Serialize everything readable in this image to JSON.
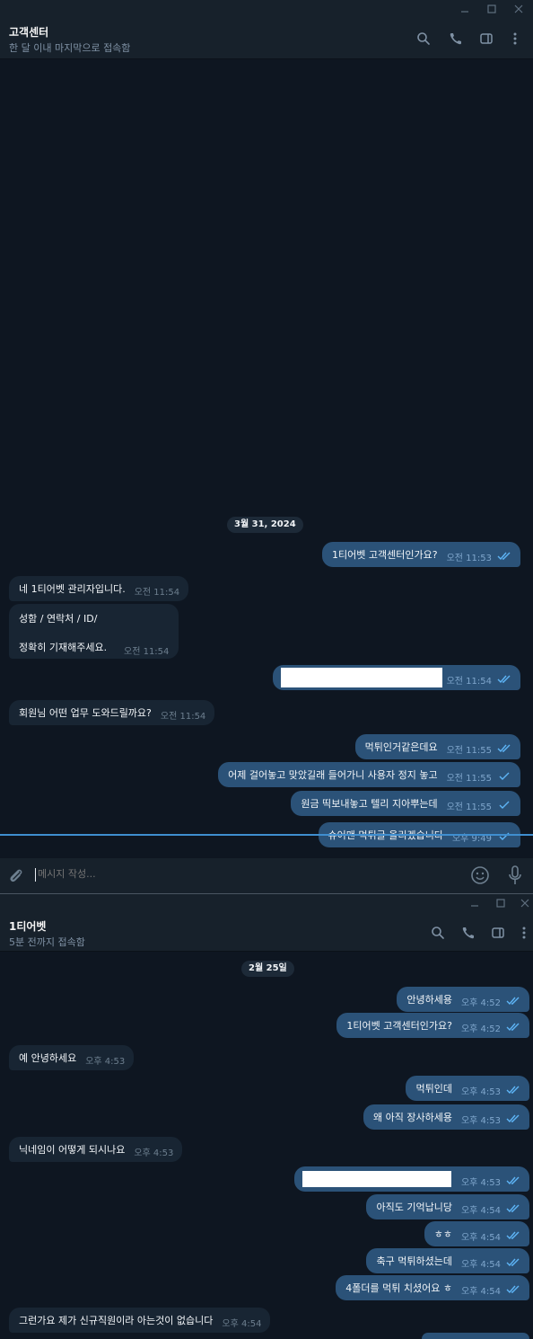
{
  "window1": {
    "title": "고객센터",
    "subtitle": "한 달 이내 마지막으로 접속함",
    "date": "3월 31, 2024",
    "composer_placeholder": "메시지 작성...",
    "messages": [
      {
        "dir": "out",
        "text": "1티어벳 고객센터인가요?",
        "time": "오전 11:53",
        "tick": "double"
      },
      {
        "dir": "in",
        "text": "네 1티어벳 관리자입니다.",
        "time": "오전 11:54"
      },
      {
        "dir": "in",
        "lines": [
          "성함 / 연락처 / ID/",
          "정확히 기재해주세요."
        ],
        "time": "오전 11:54"
      },
      {
        "dir": "out",
        "text": "",
        "redacted": true,
        "time": "오전 11:54",
        "tick": "double"
      },
      {
        "dir": "in",
        "text": "회원님 어떤 업무 도와드릴까요?",
        "time": "오전 11:54"
      },
      {
        "dir": "out",
        "text": "먹튀인거같은데요",
        "time": "오전 11:55",
        "tick": "double"
      },
      {
        "dir": "out",
        "text": "어제 걸어놓고 맞았길래 들어가니 사용자 정지 놓고",
        "time": "오전 11:55",
        "tick": "single"
      },
      {
        "dir": "out",
        "text": "원금 띡보내놓고 텔리 지아뿌는데",
        "time": "오전 11:55",
        "tick": "single"
      },
      {
        "dir": "out",
        "text": "슈어맨 먹튀글 올리겠습니다",
        "time": "오후 9:49",
        "tick": "single"
      }
    ]
  },
  "window2": {
    "title": "1티어벳",
    "subtitle": "5분 전까지 접속함",
    "date": "2월 25일",
    "messages": [
      {
        "dir": "out",
        "text": "안녕하세용",
        "time": "오후 4:52",
        "tick": "double"
      },
      {
        "dir": "out",
        "text": "1티어벳 고객센터인가요?",
        "time": "오후 4:52",
        "tick": "double"
      },
      {
        "dir": "in",
        "text": "예 안녕하세요",
        "time": "오후 4:53"
      },
      {
        "dir": "out",
        "text": "먹튀인데",
        "time": "오후 4:53",
        "tick": "double"
      },
      {
        "dir": "out",
        "text": "왜 아직 장사하세용",
        "time": "오후 4:53",
        "tick": "double"
      },
      {
        "dir": "in",
        "text": "닉네임이 어떻게 되시나요",
        "time": "오후 4:53"
      },
      {
        "dir": "out",
        "text": "",
        "redacted": true,
        "time": "오후 4:53",
        "tick": "double"
      },
      {
        "dir": "out",
        "text": "아직도 기억납니당",
        "time": "오후 4:54",
        "tick": "double"
      },
      {
        "dir": "out",
        "text": "ㅎㅎ",
        "time": "오후 4:54",
        "tick": "double"
      },
      {
        "dir": "out",
        "text": "축구 먹튀하셨는데",
        "time": "오후 4:54",
        "tick": "double"
      },
      {
        "dir": "out",
        "text": "4폴더를 먹튀 치셨어요 ㅎ",
        "time": "오후 4:54",
        "tick": "double"
      },
      {
        "dir": "in",
        "text": "그런가요 제가 신규직원이라 아는것이 없습니다",
        "time": "오후 4:54"
      }
    ]
  },
  "colors": {
    "background": "#0e1621",
    "header": "#17212b",
    "outgoing_bubble": "#2b5278",
    "incoming_bubble": "#182533",
    "accent": "#5eb5f7",
    "read_line": "#3f8ecf"
  },
  "icons": [
    "minimize-icon",
    "maximize-icon",
    "close-icon",
    "search-icon",
    "phone-icon",
    "sidebar-icon",
    "more-vertical-icon",
    "paperclip-icon",
    "emoji-icon",
    "microphone-icon",
    "double-check-icon",
    "check-icon"
  ]
}
